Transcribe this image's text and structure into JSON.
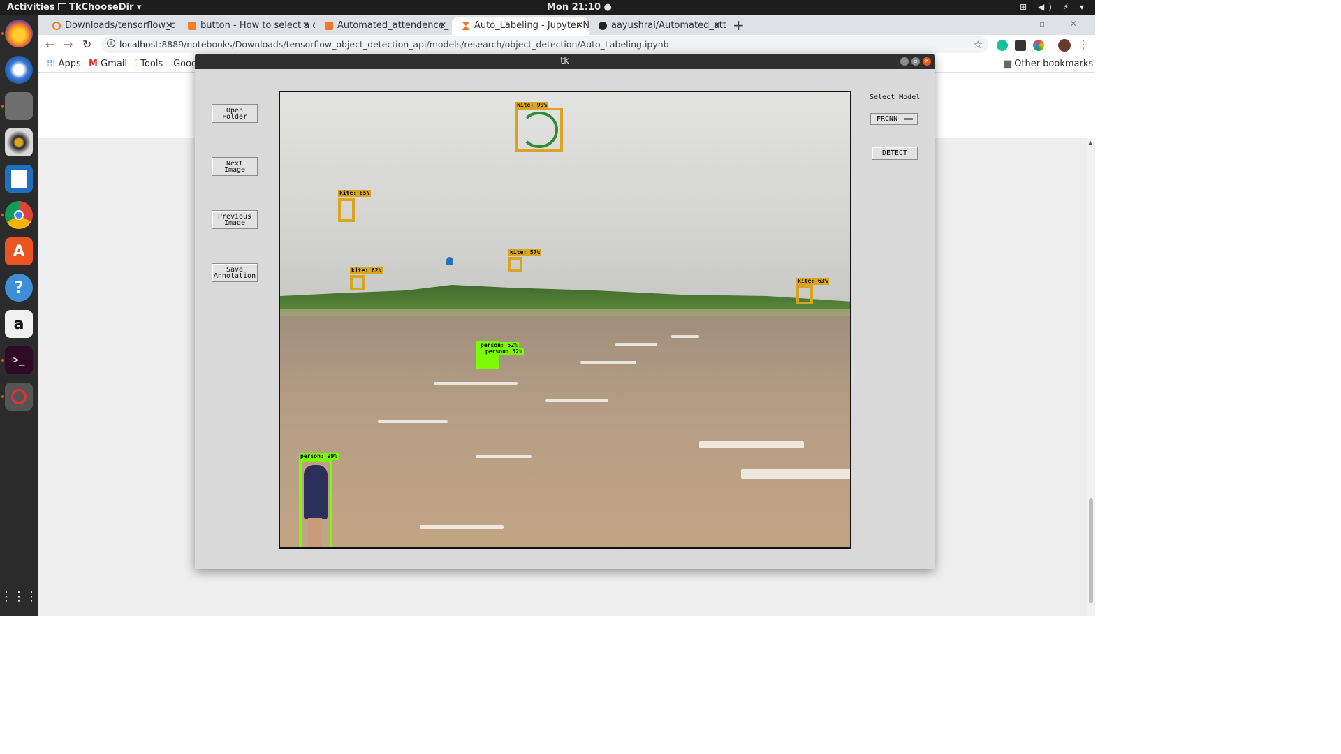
{
  "topbar": {
    "activities": "Activities",
    "app_menu": "TkChooseDir ▾",
    "clock": "Mon 21:10 ●",
    "tray": "⊞ ◀) ⚡ ▾"
  },
  "dock": {
    "items": [
      "firefox-icon",
      "thunderbird-icon",
      "files-icon",
      "rhythmbox-icon",
      "writer-icon",
      "chrome-icon",
      "software-icon",
      "help-icon",
      "amazon-icon",
      "terminal-icon",
      "tk-app-icon"
    ],
    "show_apps_glyph": "⋮⋮⋮"
  },
  "browser": {
    "tabs": [
      {
        "label": "Downloads/tensorflow_c",
        "active": false
      },
      {
        "label": "button - How to select a d",
        "active": false
      },
      {
        "label": "Automated_attendence_",
        "active": false
      },
      {
        "label": "Auto_Labeling - Jupyter N",
        "active": true
      },
      {
        "label": "aayushrai/Automated_att",
        "active": false
      }
    ],
    "tab_close": "✕",
    "new_tab": "+",
    "window_controls": "–  ▫  ✕",
    "url_host": "localhost",
    "url_path": ":8889/notebooks/Downloads/tensorflow_object_detection_api/models/research/object_detection/Auto_Labeling.ipynb",
    "bookmarks": {
      "apps": "Apps",
      "gmail": "Gmail",
      "tools": "Tools – Goog",
      "other": "Other bookmarks"
    }
  },
  "tk": {
    "title": "tk",
    "buttons": {
      "open_folder": "Open\nFolder",
      "next_image": "Next\nImage",
      "previous_image": "Previous\nImage",
      "save_annotation": "Save\nAnnotation"
    },
    "select_model_label": "Select Model",
    "selected_model": "FRCNN",
    "detect": "DETECT",
    "detections": [
      {
        "label": "kite: 99%",
        "class": "kite"
      },
      {
        "label": "kite: 85%",
        "class": "kite"
      },
      {
        "label": "kite: 57%",
        "class": "kite"
      },
      {
        "label": "kite: 62%",
        "class": "kite"
      },
      {
        "label": "kite: 63%",
        "class": "kite"
      },
      {
        "label": "person: 52%",
        "class": "person"
      },
      {
        "label": "person: 52%",
        "class": "person"
      },
      {
        "label": "person: 99%",
        "class": "person"
      }
    ]
  }
}
